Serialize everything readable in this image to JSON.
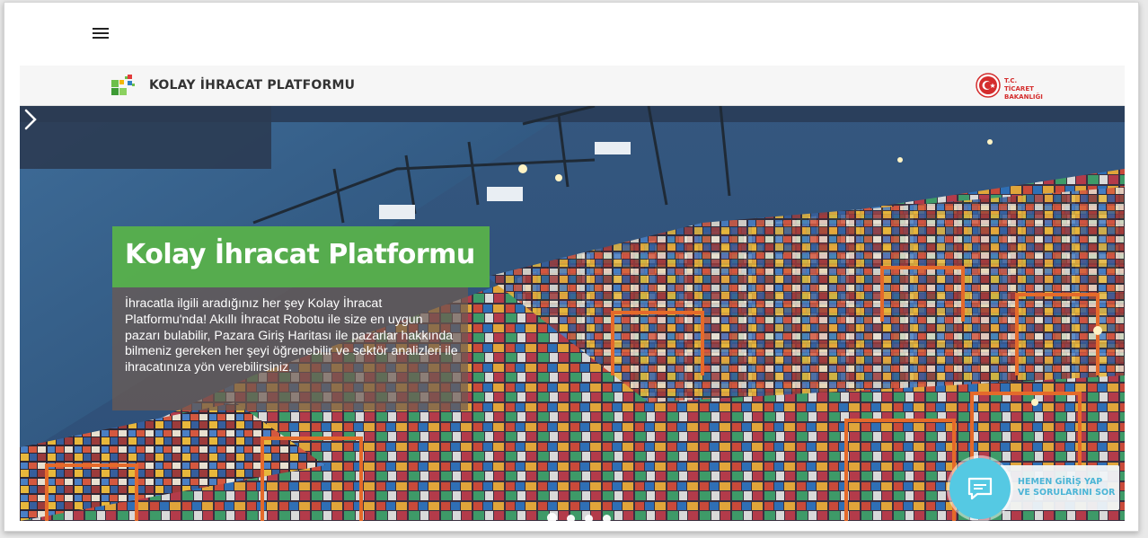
{
  "header": {
    "menu_icon": "hamburger-icon"
  },
  "brand": {
    "name": "KOLAY İHRACAT PLATFORMU",
    "logo_icon": "kip-logo-icon",
    "ministry_line1": "T.C. TİCARET",
    "ministry_line2": "BAKANLIĞI"
  },
  "hero": {
    "title": "Kolay İhracat Platformu",
    "description": "İhracatla ilgili aradığınız her şey Kolay İhracat Platformu'nda! Akıllı İhracat Robotu ile size en uygun pazarı bulabilir, Pazara Giriş Haritası ile pazarlar hakkında bilmeniz gereken her şeyi öğrenebilir ve sektör analizleri ile ihracatınıza yön verebilirsiniz.",
    "next_icon": "chevron-right-icon",
    "slides_total": 4,
    "active_slide": 1
  },
  "chat": {
    "line1": "HEMEN GİRİŞ YAP",
    "line2": "VE SORULARINI SOR",
    "icon": "chat-icon"
  },
  "colors": {
    "green": "#58b14a",
    "chat": "#55c9e3",
    "ministry_red": "#d42d2d"
  }
}
